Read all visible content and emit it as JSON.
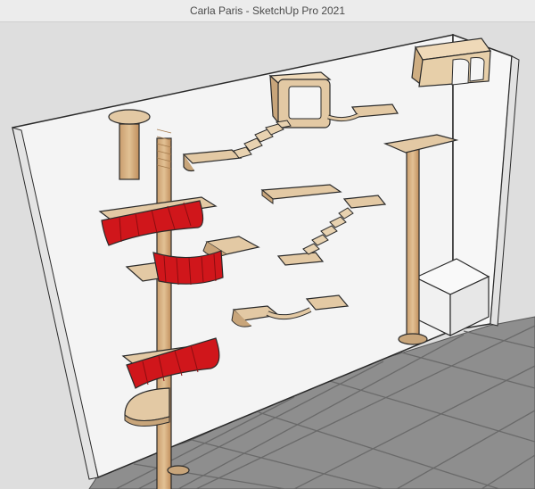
{
  "window": {
    "title": "Carla Paris - SketchUp Pro 2021"
  },
  "scene": {
    "model": "cat-climbing-wall",
    "colors": {
      "wall": "#f4f4f4",
      "wall_edge": "#e6e6e6",
      "floor_tile": "#8c8c8c",
      "floor_grout": "#6e6e6e",
      "wood": "#e3c9a4",
      "wood_dark": "#c8a57a",
      "post": "#d9b48a",
      "carpet": "#d0161b",
      "carpet_dark": "#9e0f12",
      "outline": "#2a2a2a",
      "background": "#dedede"
    }
  }
}
